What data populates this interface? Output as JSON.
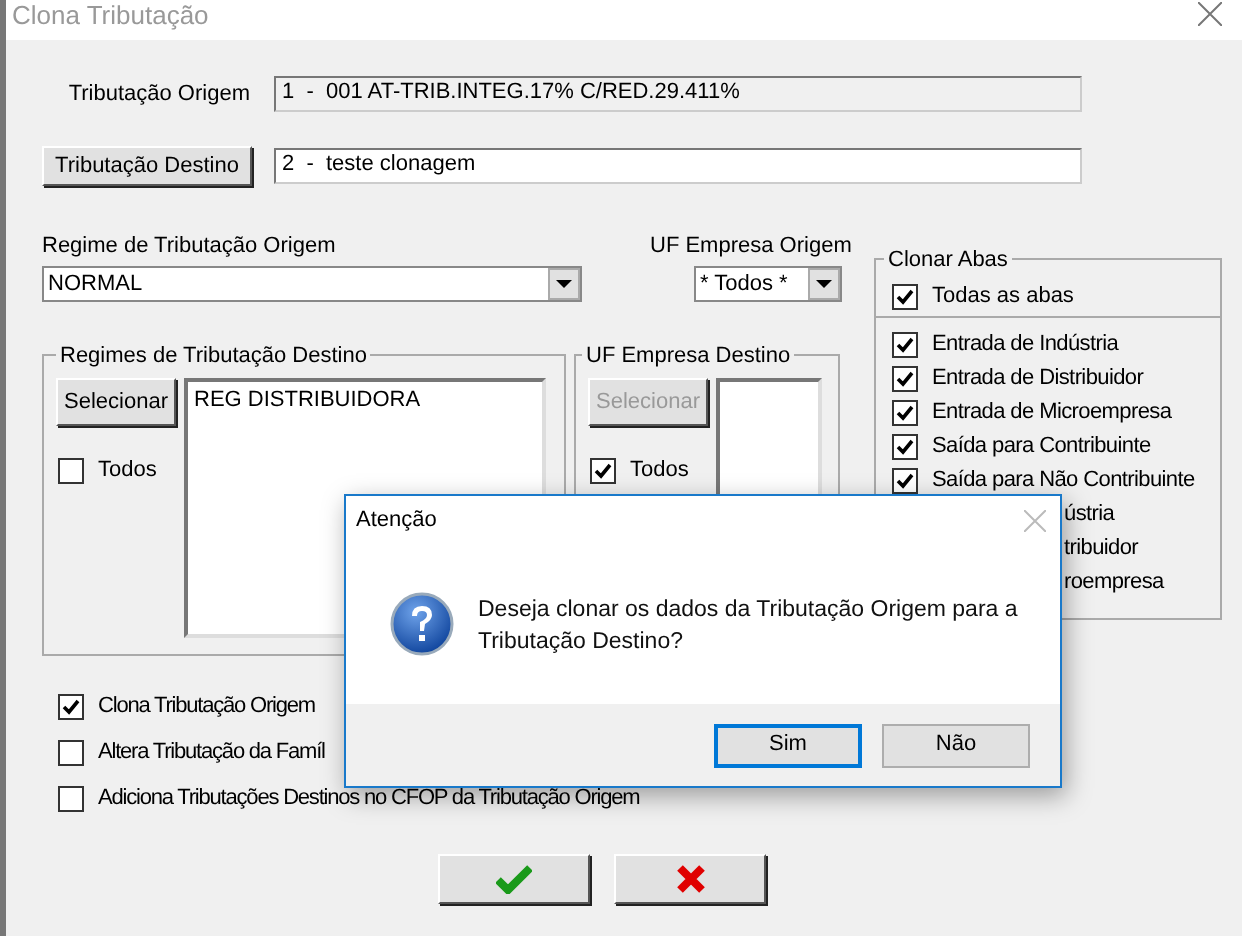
{
  "window": {
    "title": "Clona Tributação"
  },
  "origem": {
    "label": "Tributação Origem",
    "value": "1  -  001 AT-TRIB.INTEG.17% C/RED.29.411%"
  },
  "destino": {
    "button": "Tributação Destino",
    "value": "2  -  teste clonagem"
  },
  "regime_origem": {
    "label": "Regime de Tributação Origem",
    "value": "NORMAL"
  },
  "uf_origem": {
    "label": "UF Empresa Origem",
    "value": "* Todos *"
  },
  "regimes_destino": {
    "title": "Regimes de Tributação Destino",
    "button": {
      "label": "Selecionar",
      "disabled": false
    },
    "items": [
      "REG DISTRIBUIDORA"
    ],
    "todos": {
      "label": "Todos",
      "checked": false
    }
  },
  "uf_destino": {
    "title": "UF Empresa Destino",
    "button": {
      "label": "Selecionar",
      "disabled": true
    },
    "todos": {
      "label": "Todos",
      "checked": true
    }
  },
  "clonar_abas": {
    "title": "Clonar Abas",
    "all": {
      "label": "Todas as abas",
      "checked": true
    },
    "items": [
      {
        "kind": "checkbox",
        "label": "Entrada de Indústria",
        "checked": true
      },
      {
        "kind": "checkbox",
        "label": "Entrada de Distribuidor",
        "checked": true
      },
      {
        "kind": "checkbox",
        "label": "Entrada de Microempresa",
        "checked": true
      },
      {
        "kind": "checkbox",
        "label": "Saída para Contribuinte",
        "checked": true
      },
      {
        "kind": "checkbox",
        "label": "Saída para Não Contribuinte",
        "checked": true
      },
      {
        "kind": "covered",
        "label": "ústria"
      },
      {
        "kind": "covered",
        "label": "tribuidor"
      },
      {
        "kind": "covered",
        "label": "roempresa"
      }
    ]
  },
  "options": [
    {
      "label": "Clona Tributação Origem",
      "checked": true
    },
    {
      "label": "Altera Tributação da Famíl",
      "checked": false
    },
    {
      "label": "Adiciona Tributações Destinos no CFOP da Tributação Origem",
      "checked": false
    }
  ],
  "dialog": {
    "title": "Atenção",
    "message": "Deseja clonar os dados da Tributação Origem para a Tributação Destino?",
    "buttons": [
      {
        "label": "Sim",
        "selected": true
      },
      {
        "label": "Não",
        "selected": false
      }
    ]
  }
}
